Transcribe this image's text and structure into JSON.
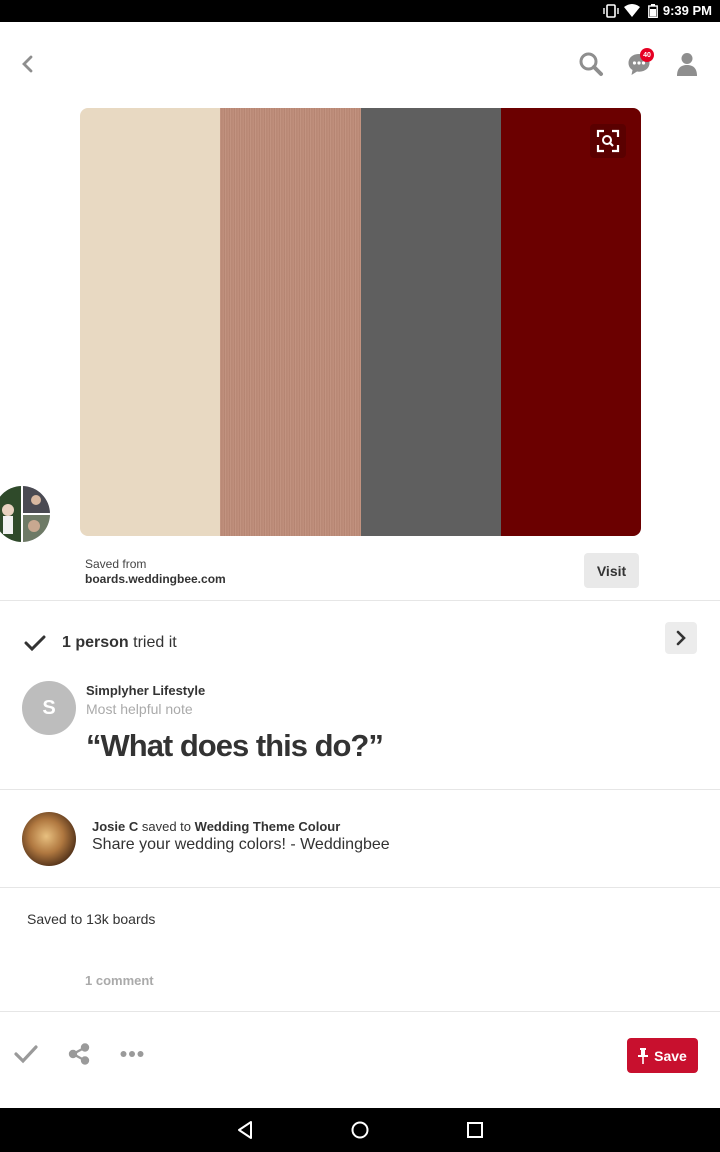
{
  "status_bar": {
    "time": "9:39 PM",
    "icons": [
      "vibrate-icon",
      "wifi-icon",
      "battery-icon"
    ]
  },
  "header": {
    "icons": [
      "back-icon",
      "search-icon",
      "messages-icon",
      "profile-icon"
    ],
    "message_badge": "40"
  },
  "pin": {
    "swatches": [
      "#e8d9c2",
      "#c08c78",
      "#5f5f5f",
      "#6b0000"
    ],
    "saved_from_label": "Saved from",
    "source_domain": "boards.weddingbee.com",
    "visit_label": "Visit"
  },
  "tried": {
    "count_text": "1 person",
    "suffix_text": "tried it"
  },
  "note": {
    "avatar_letter": "S",
    "author": "Simplyher Lifestyle",
    "subtitle": "Most helpful note",
    "quote": "“What does this do?”"
  },
  "saved_by": {
    "user": "Josie C",
    "connector": "saved to",
    "board": "Wedding Theme Colour",
    "description": "Share your wedding colors! - Weddingbee"
  },
  "saved_count": "Saved to 13k boards",
  "comments": "1 comment",
  "bottom_bar": {
    "icons": [
      "check-icon",
      "share-icon",
      "more-icon"
    ],
    "save_label": "Save"
  },
  "nav_bar": {
    "icons": [
      "nav-back-icon",
      "nav-home-icon",
      "nav-recents-icon"
    ]
  },
  "colors": {
    "brand_red": "#c8102e"
  }
}
